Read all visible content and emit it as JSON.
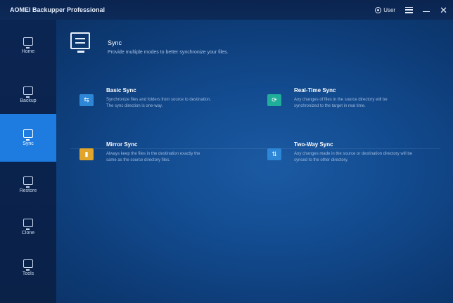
{
  "window": {
    "title": "AOMEI Backupper Professional"
  },
  "titlebar": {
    "user_label": "User"
  },
  "sidebar": {
    "items": [
      {
        "label": "Home"
      },
      {
        "label": "Backup"
      },
      {
        "label": "Sync"
      },
      {
        "label": "Restore"
      },
      {
        "label": "Clone"
      },
      {
        "label": "Tools"
      }
    ],
    "active": "Sync"
  },
  "header": {
    "title": "Sync",
    "subtitle": "Provide multiple modes to better synchronize your files."
  },
  "cards": [
    {
      "title": "Basic Sync",
      "desc": [
        "Synchronize files and folders from source to destination.",
        "The sync direction is one-way."
      ],
      "icon": "folder-sync-icon",
      "color": "#2e86d6"
    },
    {
      "title": "Real-Time Sync",
      "desc": [
        "Any changes of files in the source directory will be",
        "synchronized to the target in real time."
      ],
      "icon": "realtime-sync-icon",
      "color": "#1fae9a"
    },
    {
      "title": "Mirror Sync",
      "desc": [
        "Always keep the files in the destination exactly the",
        "same as the source directory files."
      ],
      "icon": "mirror-sync-icon",
      "color": "#e0a52a"
    },
    {
      "title": "Two-Way Sync",
      "desc": [
        "Any changes made in the source or destination directory will be",
        "synced to the other directory."
      ],
      "icon": "two-way-sync-icon",
      "color": "#2e86d6"
    }
  ]
}
